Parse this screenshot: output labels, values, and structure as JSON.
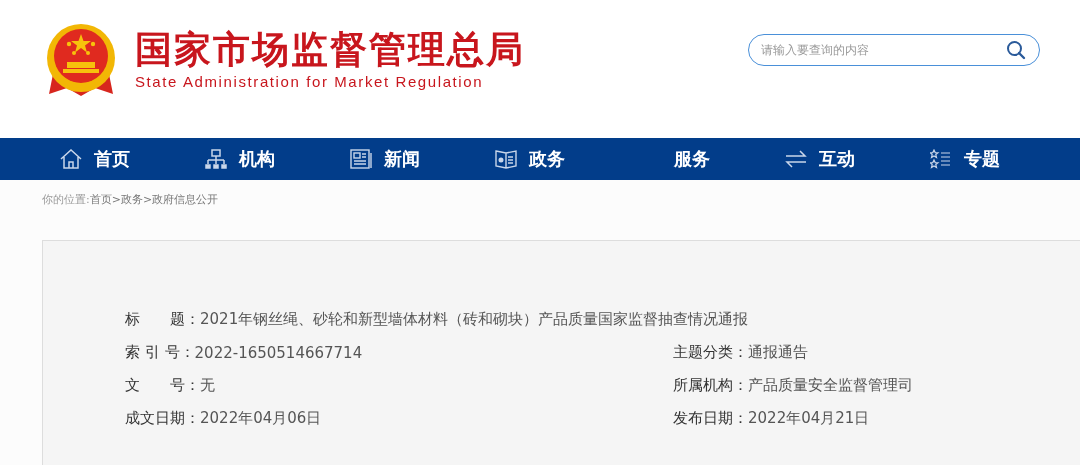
{
  "header": {
    "title": "国家市场监督管理总局",
    "subtitle": "State Administration for Market Regulation",
    "search": {
      "placeholder": "请输入要查询的内容"
    }
  },
  "nav": [
    {
      "label": "首页",
      "kind": "home"
    },
    {
      "label": "机构",
      "kind": "org"
    },
    {
      "label": "新闻",
      "kind": "news"
    },
    {
      "label": "政务",
      "kind": "gov"
    },
    {
      "label": "服务",
      "kind": "none"
    },
    {
      "label": "互动",
      "kind": "swap"
    },
    {
      "label": "专题",
      "kind": "topics"
    }
  ],
  "breadcrumb": {
    "label": "你的位置:",
    "separator": ">",
    "items": [
      "首页",
      "政务",
      "政府信息公开"
    ]
  },
  "info": {
    "title": {
      "label": "标　　题：",
      "value": "2021年钢丝绳、砂轮和新型墙体材料（砖和砌块）产品质量国家监督抽查情况通报"
    },
    "fields": [
      {
        "label": "索 引 号：",
        "value": "2022-1650514667714"
      },
      {
        "label": "主题分类：",
        "value": "通报通告"
      },
      {
        "label": "文　　号：",
        "value": "无"
      },
      {
        "label": "所属机构：",
        "value": "产品质量安全监督管理司"
      },
      {
        "label": "成文日期：",
        "value": "2022年04月06日"
      },
      {
        "label": "发布日期：",
        "value": "2022年04月21日"
      }
    ]
  }
}
